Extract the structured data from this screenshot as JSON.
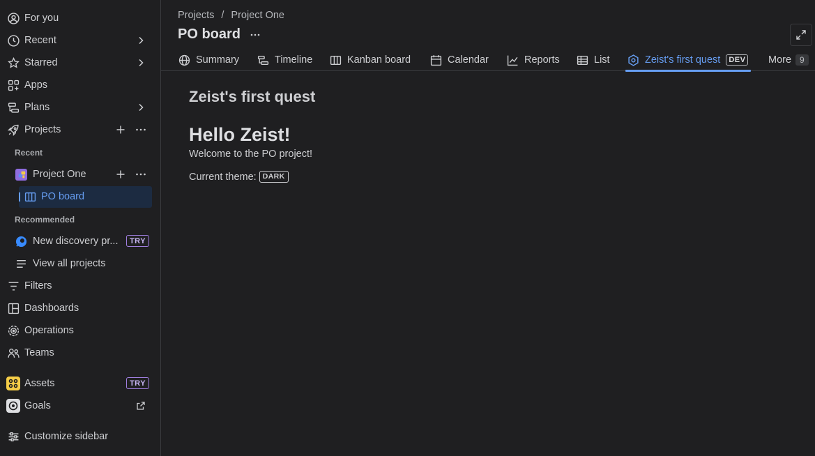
{
  "sidebar": {
    "for_you": "For you",
    "recent": "Recent",
    "starred": "Starred",
    "apps": "Apps",
    "plans": "Plans",
    "projects": "Projects",
    "recent_header": "Recent",
    "project_one": "Project One",
    "po_board": "PO board",
    "recommended_header": "Recommended",
    "new_discovery": "New discovery pr...",
    "try_label": "TRY",
    "view_all_projects": "View all projects",
    "filters": "Filters",
    "dashboards": "Dashboards",
    "operations": "Operations",
    "teams": "Teams",
    "assets": "Assets",
    "goals": "Goals",
    "customize": "Customize sidebar"
  },
  "header": {
    "breadcrumb_projects": "Projects",
    "breadcrumb_sep": "/",
    "breadcrumb_project": "Project One",
    "title": "PO board"
  },
  "tabs": {
    "summary": "Summary",
    "timeline": "Timeline",
    "kanban": "Kanban board",
    "calendar": "Calendar",
    "reports": "Reports",
    "list": "List",
    "quest": "Zeist's first quest",
    "dev_badge": "DEV",
    "more": "More",
    "more_count": "9"
  },
  "content": {
    "quest_title": "Zeist's first quest",
    "hello": "Hello Zeist!",
    "welcome": "Welcome to the PO project!",
    "theme_label": "Current theme:",
    "theme_value": "DARK"
  },
  "colors": {
    "background": "#1f1f21",
    "accent": "#669df1",
    "try_border": "#a07fe0",
    "assets_icon": "#f5cd47"
  }
}
